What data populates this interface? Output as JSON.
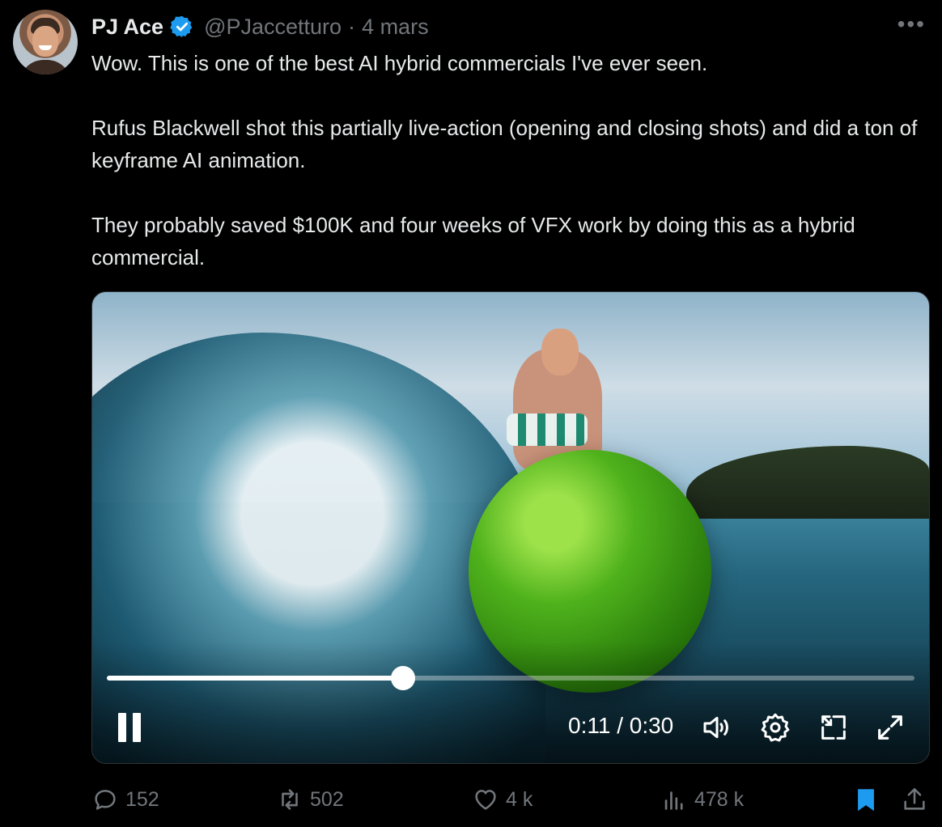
{
  "author": {
    "name": "PJ Ace",
    "handle": "@PJaccetturo",
    "separator": "·",
    "date": "4 mars",
    "verified": true
  },
  "tweet": {
    "paragraphs": [
      "Wow. This is one of the best AI hybrid commercials I've ever seen.",
      "Rufus Blackwell shot this partially live-action (opening and closing shots) and did a ton of keyframe AI animation.",
      "They probably saved $100K and four weeks of VFX work by doing this as a hybrid commercial."
    ]
  },
  "video": {
    "time_display": "0:11 / 0:30",
    "progress_fraction": 0.3667
  },
  "actions": {
    "replies": "152",
    "reposts": "502",
    "likes": "4 k",
    "views": "478 k"
  },
  "colors": {
    "background": "#000000",
    "verified_badge": "#1d9bf0",
    "bookmark_active": "#1d9bf0",
    "muted_text": "#71767b"
  },
  "icons": [
    "more-icon",
    "verified-icon",
    "pause-icon",
    "volume-icon",
    "settings-icon",
    "minimize-icon",
    "fullscreen-icon",
    "reply-icon",
    "repost-icon",
    "like-icon",
    "views-icon",
    "bookmark-icon",
    "share-icon"
  ]
}
